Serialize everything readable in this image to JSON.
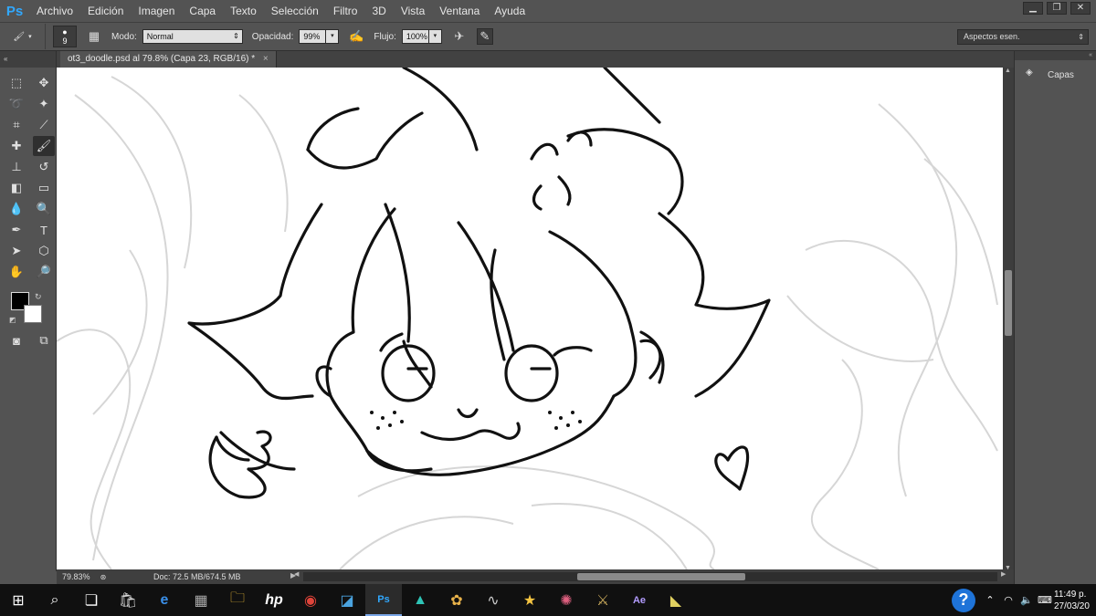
{
  "app": {
    "logo": "Ps",
    "menu": [
      "Archivo",
      "Edición",
      "Imagen",
      "Capa",
      "Texto",
      "Selección",
      "Filtro",
      "3D",
      "Vista",
      "Ventana",
      "Ayuda"
    ]
  },
  "options": {
    "brush_size": "9",
    "mode_label": "Modo:",
    "mode_value": "Normal",
    "opacity_label": "Opacidad:",
    "opacity_value": "99%",
    "flow_label": "Flujo:",
    "flow_value": "100%",
    "workspace": "Aspectos esen."
  },
  "document": {
    "tab_title": "ot3_doodle.psd al 79.8% (Capa 23, RGB/16) *",
    "close": "×"
  },
  "status": {
    "zoom": "79.83%",
    "doc_info": "Doc: 72.5 MB/674.5 MB"
  },
  "panels": {
    "layers_label": "Capas",
    "collapse": "«"
  },
  "taskbar": {
    "time": "11:49 p.",
    "date": "27/03/20"
  },
  "colors": {
    "foreground": "#000000",
    "background": "#ffffff",
    "accent": "#31a8ff"
  }
}
